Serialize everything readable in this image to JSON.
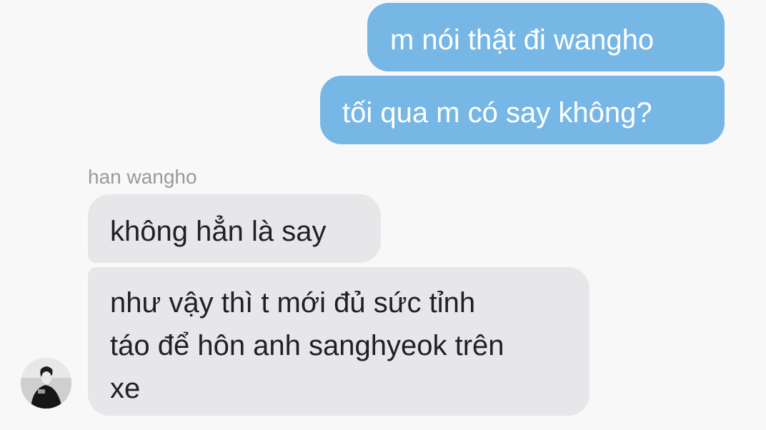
{
  "conversation": {
    "outgoing": [
      {
        "text": "m nói thật đi wangho"
      },
      {
        "text": "tối qua m có say không?"
      }
    ],
    "incoming_sender": "han wangho",
    "incoming": [
      {
        "text": "không hẳn là say"
      },
      {
        "lines": [
          "như vậy thì t mới đủ sức tỉnh",
          "táo để hôn anh sanghyeok trên",
          "xe"
        ]
      }
    ]
  },
  "colors": {
    "outgoing_bubble": "#77b7e6",
    "incoming_bubble": "#e7e7ea",
    "background": "#f8f8f9",
    "sender_label": "#9a9a9e"
  },
  "icons": {
    "avatar": "person-avatar"
  }
}
